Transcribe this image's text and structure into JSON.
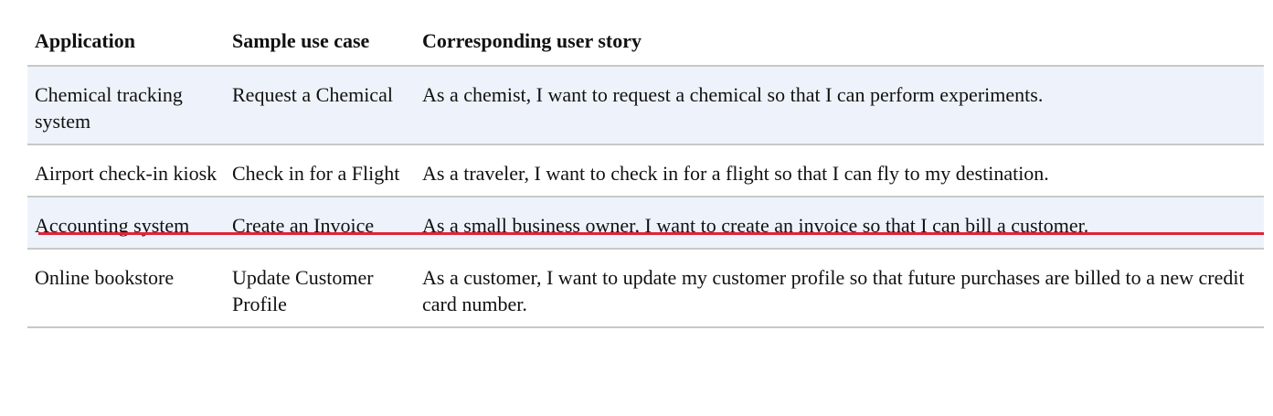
{
  "table": {
    "headers": [
      "Application",
      "Sample use case",
      "Corresponding user story"
    ],
    "rows": [
      {
        "application": "Chemical tracking system",
        "use_case": "Request a Chemical",
        "user_story": "As a chemist, I want to request a chemical so that I can perform experiments."
      },
      {
        "application": "Airport check-in kiosk",
        "use_case": "Check in for a Flight",
        "user_story": "As a traveler, I want to check in for a flight so that I can fly to my destination."
      },
      {
        "application": "Accounting system",
        "use_case": "Create an Invoice",
        "user_story": "As a small business owner, I want to create an invoice so that I can bill a customer."
      },
      {
        "application": "Online bookstore",
        "use_case": "Update Customer Profile",
        "user_story": "As a customer, I want to update my customer profile so that future purchases are billed to a new credit card number."
      }
    ]
  },
  "colors": {
    "row_shade": "#eef3fb",
    "divider": "#c8c8c8",
    "highlight_line": "#e0233a"
  }
}
